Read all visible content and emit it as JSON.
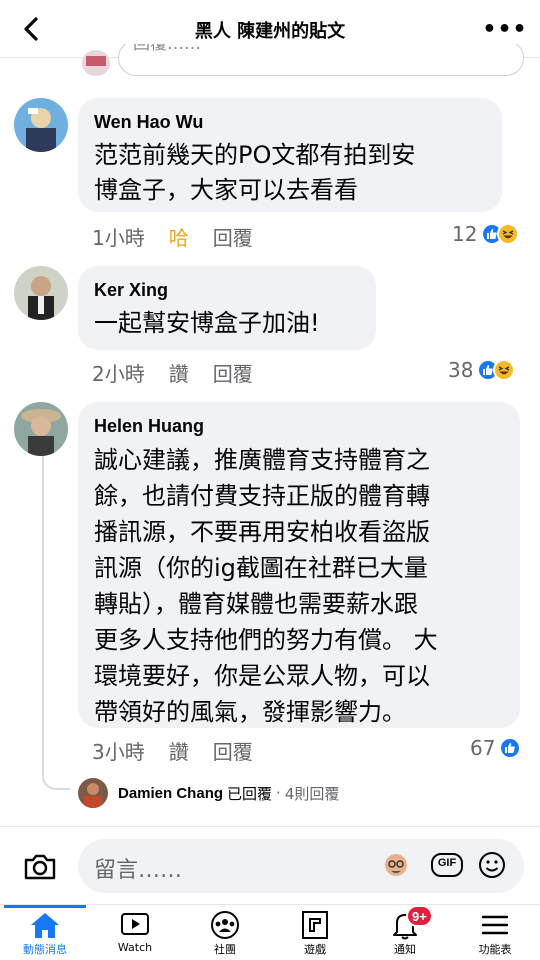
{
  "header": {
    "title": "黑人 陳建州的貼文"
  },
  "top_reply": {
    "placeholder": "回覆……"
  },
  "comments": [
    {
      "name": "Wen Hao Wu",
      "text": "范范前幾天的PO文都有拍到安\n博盒子，大家可以去看看",
      "time": "1小時",
      "like_action": "哈",
      "reply_action": "回覆",
      "reaction_count": "12",
      "reactions": [
        "like-icon",
        "haha-icon"
      ]
    },
    {
      "name": "Ker Xing",
      "text": "一起幫安博盒子加油!",
      "time": "2小時",
      "like_action": "讚",
      "reply_action": "回覆",
      "reaction_count": "38",
      "reactions": [
        "like-icon",
        "haha-icon"
      ]
    },
    {
      "name": "Helen Huang",
      "text": "誠心建議，推廣體育支持體育之\n餘，也請付費支持正版的體育轉\n播訊源，不要再用安柏收看盜版\n訊源（你的ig截圖在社群已大量\n轉貼），體育媒體也需要薪水跟\n更多人支持他們的努力有償。 大\n環境要好，你是公眾人物，可以\n帶領好的風氣，發揮影響力。",
      "time": "3小時",
      "like_action": "讚",
      "reply_action": "回覆",
      "reaction_count": "67",
      "reactions": [
        "like-icon"
      ]
    }
  ],
  "reply_summary": {
    "name": "Damien Chang",
    "action": "已回覆",
    "sep": "·",
    "count": "4則回覆"
  },
  "input_bar": {
    "placeholder": "留言……",
    "gif_label": "GIF"
  },
  "tabs": [
    {
      "label": "動態消息",
      "icon": "home-icon",
      "active": true
    },
    {
      "label": "Watch",
      "icon": "watch-icon"
    },
    {
      "label": "社團",
      "icon": "groups-icon"
    },
    {
      "label": "遊戲",
      "icon": "gaming-icon"
    },
    {
      "label": "通知",
      "icon": "bell-icon",
      "badge": "9+"
    },
    {
      "label": "功能表",
      "icon": "menu-icon"
    }
  ],
  "colors": {
    "accent": "#1877f2",
    "badge": "#e41e3f",
    "haha": "#f7b928",
    "bubble": "#f0f2f5"
  }
}
